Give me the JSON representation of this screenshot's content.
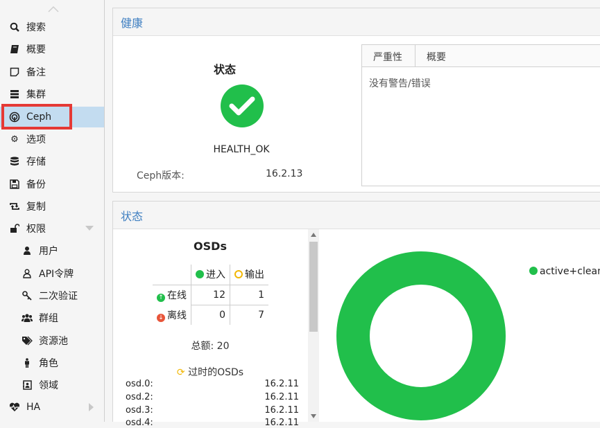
{
  "sidebar": {
    "items": [
      {
        "label": "搜索"
      },
      {
        "label": "概要"
      },
      {
        "label": "备注"
      },
      {
        "label": "集群"
      },
      {
        "label": "Ceph"
      },
      {
        "label": "选项"
      },
      {
        "label": "存储"
      },
      {
        "label": "备份"
      },
      {
        "label": "复制"
      },
      {
        "label": "权限"
      },
      {
        "label": "用户"
      },
      {
        "label": "API令牌"
      },
      {
        "label": "二次验证"
      },
      {
        "label": "群组"
      },
      {
        "label": "资源池"
      },
      {
        "label": "角色"
      },
      {
        "label": "领域"
      },
      {
        "label": "HA"
      }
    ]
  },
  "health": {
    "header": "健康",
    "status_title": "状态",
    "status_value": "HEALTH_OK",
    "version_label": "Ceph版本:",
    "version_value": "16.2.13",
    "table_headers": {
      "severity": "严重性",
      "summary": "概要"
    },
    "empty_text": "没有警告/错误"
  },
  "status": {
    "header": "状态",
    "osds_title": "OSDs",
    "col_in": "进入",
    "col_out": "输出",
    "row_up": "在线",
    "row_down": "离线",
    "up_in": "12",
    "up_out": "1",
    "down_in": "0",
    "down_out": "7",
    "total": "总额: 20",
    "outdated_title": "过时的OSDs",
    "outdated": [
      {
        "name": "osd.0:",
        "version": "16.2.11"
      },
      {
        "name": "osd.2:",
        "version": "16.2.11"
      },
      {
        "name": "osd.3:",
        "version": "16.2.11"
      },
      {
        "name": "osd.4:",
        "version": "16.2.11"
      }
    ],
    "pg_legend": "active+clean:"
  },
  "colors": {
    "green": "#21bf4b",
    "red": "#e53935",
    "accent": "#3f7fc1",
    "selected": "#c3dcf0"
  }
}
